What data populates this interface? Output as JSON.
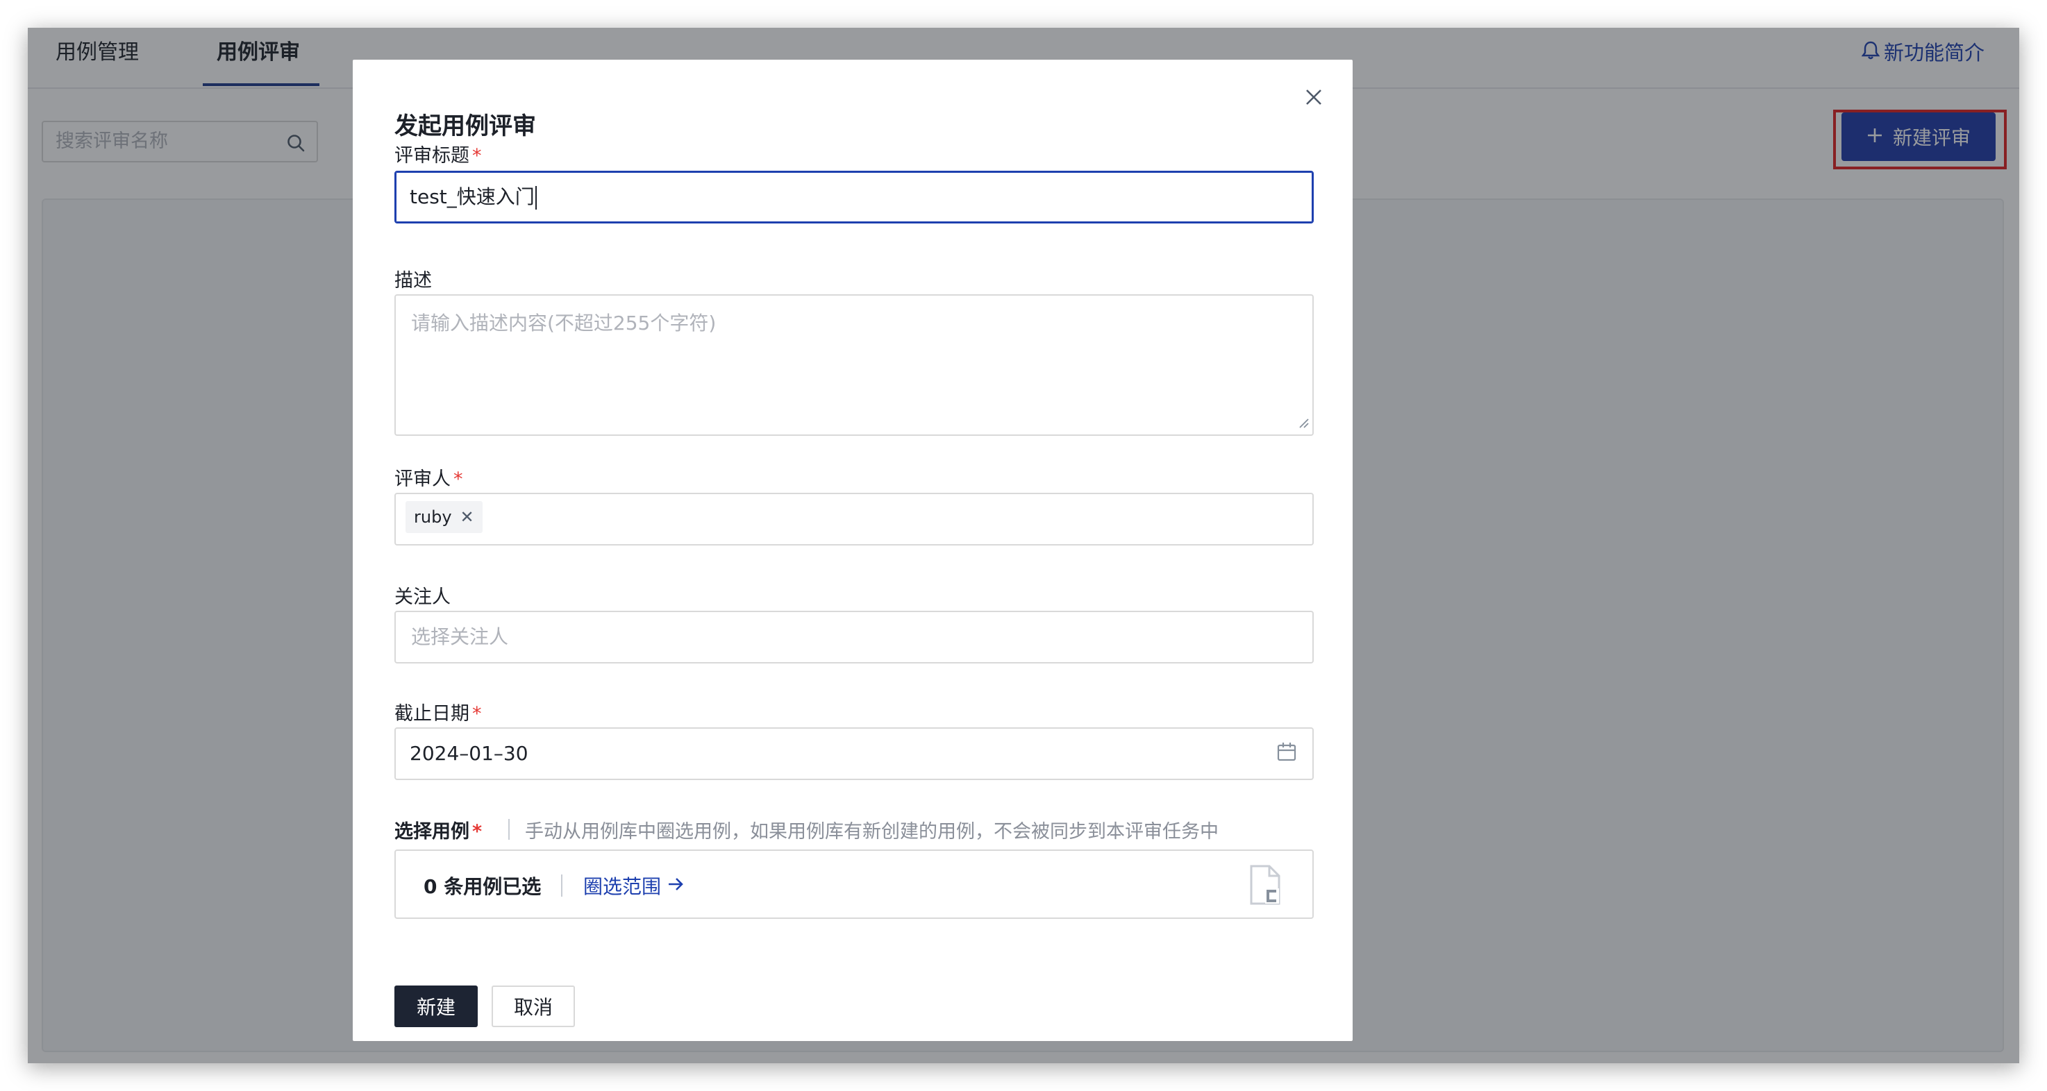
{
  "header": {
    "tabs": [
      {
        "label": "用例管理",
        "active": false
      },
      {
        "label": "用例评审",
        "active": true
      }
    ],
    "whats_new": "新功能简介"
  },
  "toolbar": {
    "search_placeholder": "搜索评审名称",
    "new_review_button": "新建评审"
  },
  "modal": {
    "title": "发起用例评审",
    "fields": {
      "title": {
        "label": "评审标题",
        "required": "*",
        "value": "test_快速入门"
      },
      "description": {
        "label": "描述",
        "placeholder": "请输入描述内容(不超过255个字符)"
      },
      "reviewers": {
        "label": "评审人",
        "required": "*",
        "tags": [
          "ruby"
        ]
      },
      "followers": {
        "label": "关注人",
        "placeholder": "选择关注人"
      },
      "deadline": {
        "label": "截止日期",
        "required": "*",
        "value": "2024–01–30"
      }
    },
    "case_select": {
      "label": "选择用例",
      "required": "*",
      "hint": "手动从用例库中圈选用例，如果用例库有新创建的用例，不会被同步到本评审任务中",
      "count_text": "0 条用例已选",
      "range_link": "圈选范围"
    },
    "buttons": {
      "create": "新建",
      "cancel": "取消"
    }
  },
  "colors": {
    "primary": "#1e3aa8",
    "link": "#1e40af",
    "dark_button": "#1d2433",
    "required": "#e53935",
    "highlight": "#e02020"
  }
}
